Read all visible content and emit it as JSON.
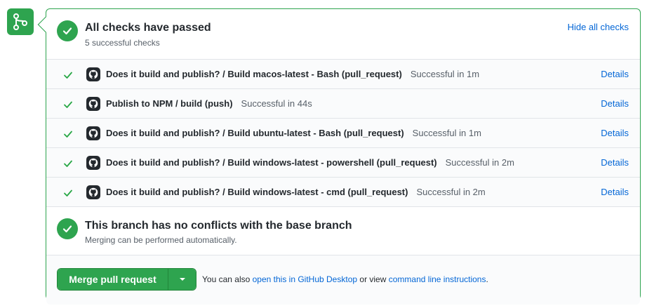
{
  "header": {
    "title": "All checks have passed",
    "subtitle": "5 successful checks",
    "hide_link": "Hide all checks"
  },
  "checks": [
    {
      "name": "Does it build and publish? / Build macos-latest - Bash (pull_request)",
      "status": "Successful in 1m",
      "details": "Details"
    },
    {
      "name": "Publish to NPM / build (push)",
      "status": "Successful in 44s",
      "details": "Details"
    },
    {
      "name": "Does it build and publish? / Build ubuntu-latest - Bash (pull_request)",
      "status": "Successful in 1m",
      "details": "Details"
    },
    {
      "name": "Does it build and publish? / Build windows-latest - powershell (pull_request)",
      "status": "Successful in 2m",
      "details": "Details"
    },
    {
      "name": "Does it build and publish? / Build windows-latest - cmd (pull_request)",
      "status": "Successful in 2m",
      "details": "Details"
    }
  ],
  "branch": {
    "title": "This branch has no conflicts with the base branch",
    "subtitle": "Merging can be performed automatically."
  },
  "merge": {
    "button_label": "Merge pull request",
    "note_prefix": "You can also",
    "desktop_link": "open this in GitHub Desktop",
    "note_middle": "or view",
    "cli_link": "command line instructions",
    "note_suffix": "."
  },
  "colors": {
    "success": "#2ea44f",
    "link": "#0366d6",
    "muted": "#586069"
  }
}
